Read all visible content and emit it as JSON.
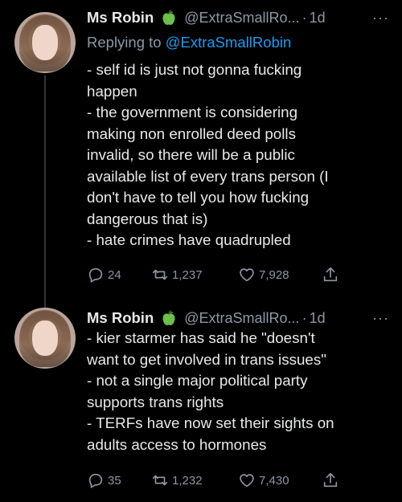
{
  "tweets": [
    {
      "name": "Ms Robin",
      "handle": "@ExtraSmallRo...",
      "dot": "·",
      "time": "1d",
      "more": "···",
      "reply_prefix": "Replying to ",
      "reply_to": "@ExtraSmallRobin",
      "lines": [
        "- self id is just not gonna fucking",
        "happen",
        "- the government is considering",
        "making non enrolled deed polls",
        "invalid, so there will be a public",
        "available list of every trans person (I",
        "don't have to tell you how fucking",
        "dangerous that is)",
        "- hate crimes have quadrupled"
      ],
      "replies": "24",
      "retweets": "1,237",
      "likes": "7,928"
    },
    {
      "name": "Ms Robin",
      "handle": "@ExtraSmallRo...",
      "dot": "·",
      "time": "1d",
      "more": "···",
      "lines": [
        "- kier starmer has said he \"doesn't",
        "want to get involved in trans issues\"",
        "- not a single major political party",
        "supports trans rights",
        "- TERFs have now set their sights on",
        "adults access to hormones"
      ],
      "replies": "35",
      "retweets": "1,232",
      "likes": "7,430"
    }
  ],
  "icons": {
    "badge": "green-apple-icon",
    "reply": "reply-icon",
    "retweet": "retweet-icon",
    "like": "heart-icon",
    "share": "share-icon"
  }
}
